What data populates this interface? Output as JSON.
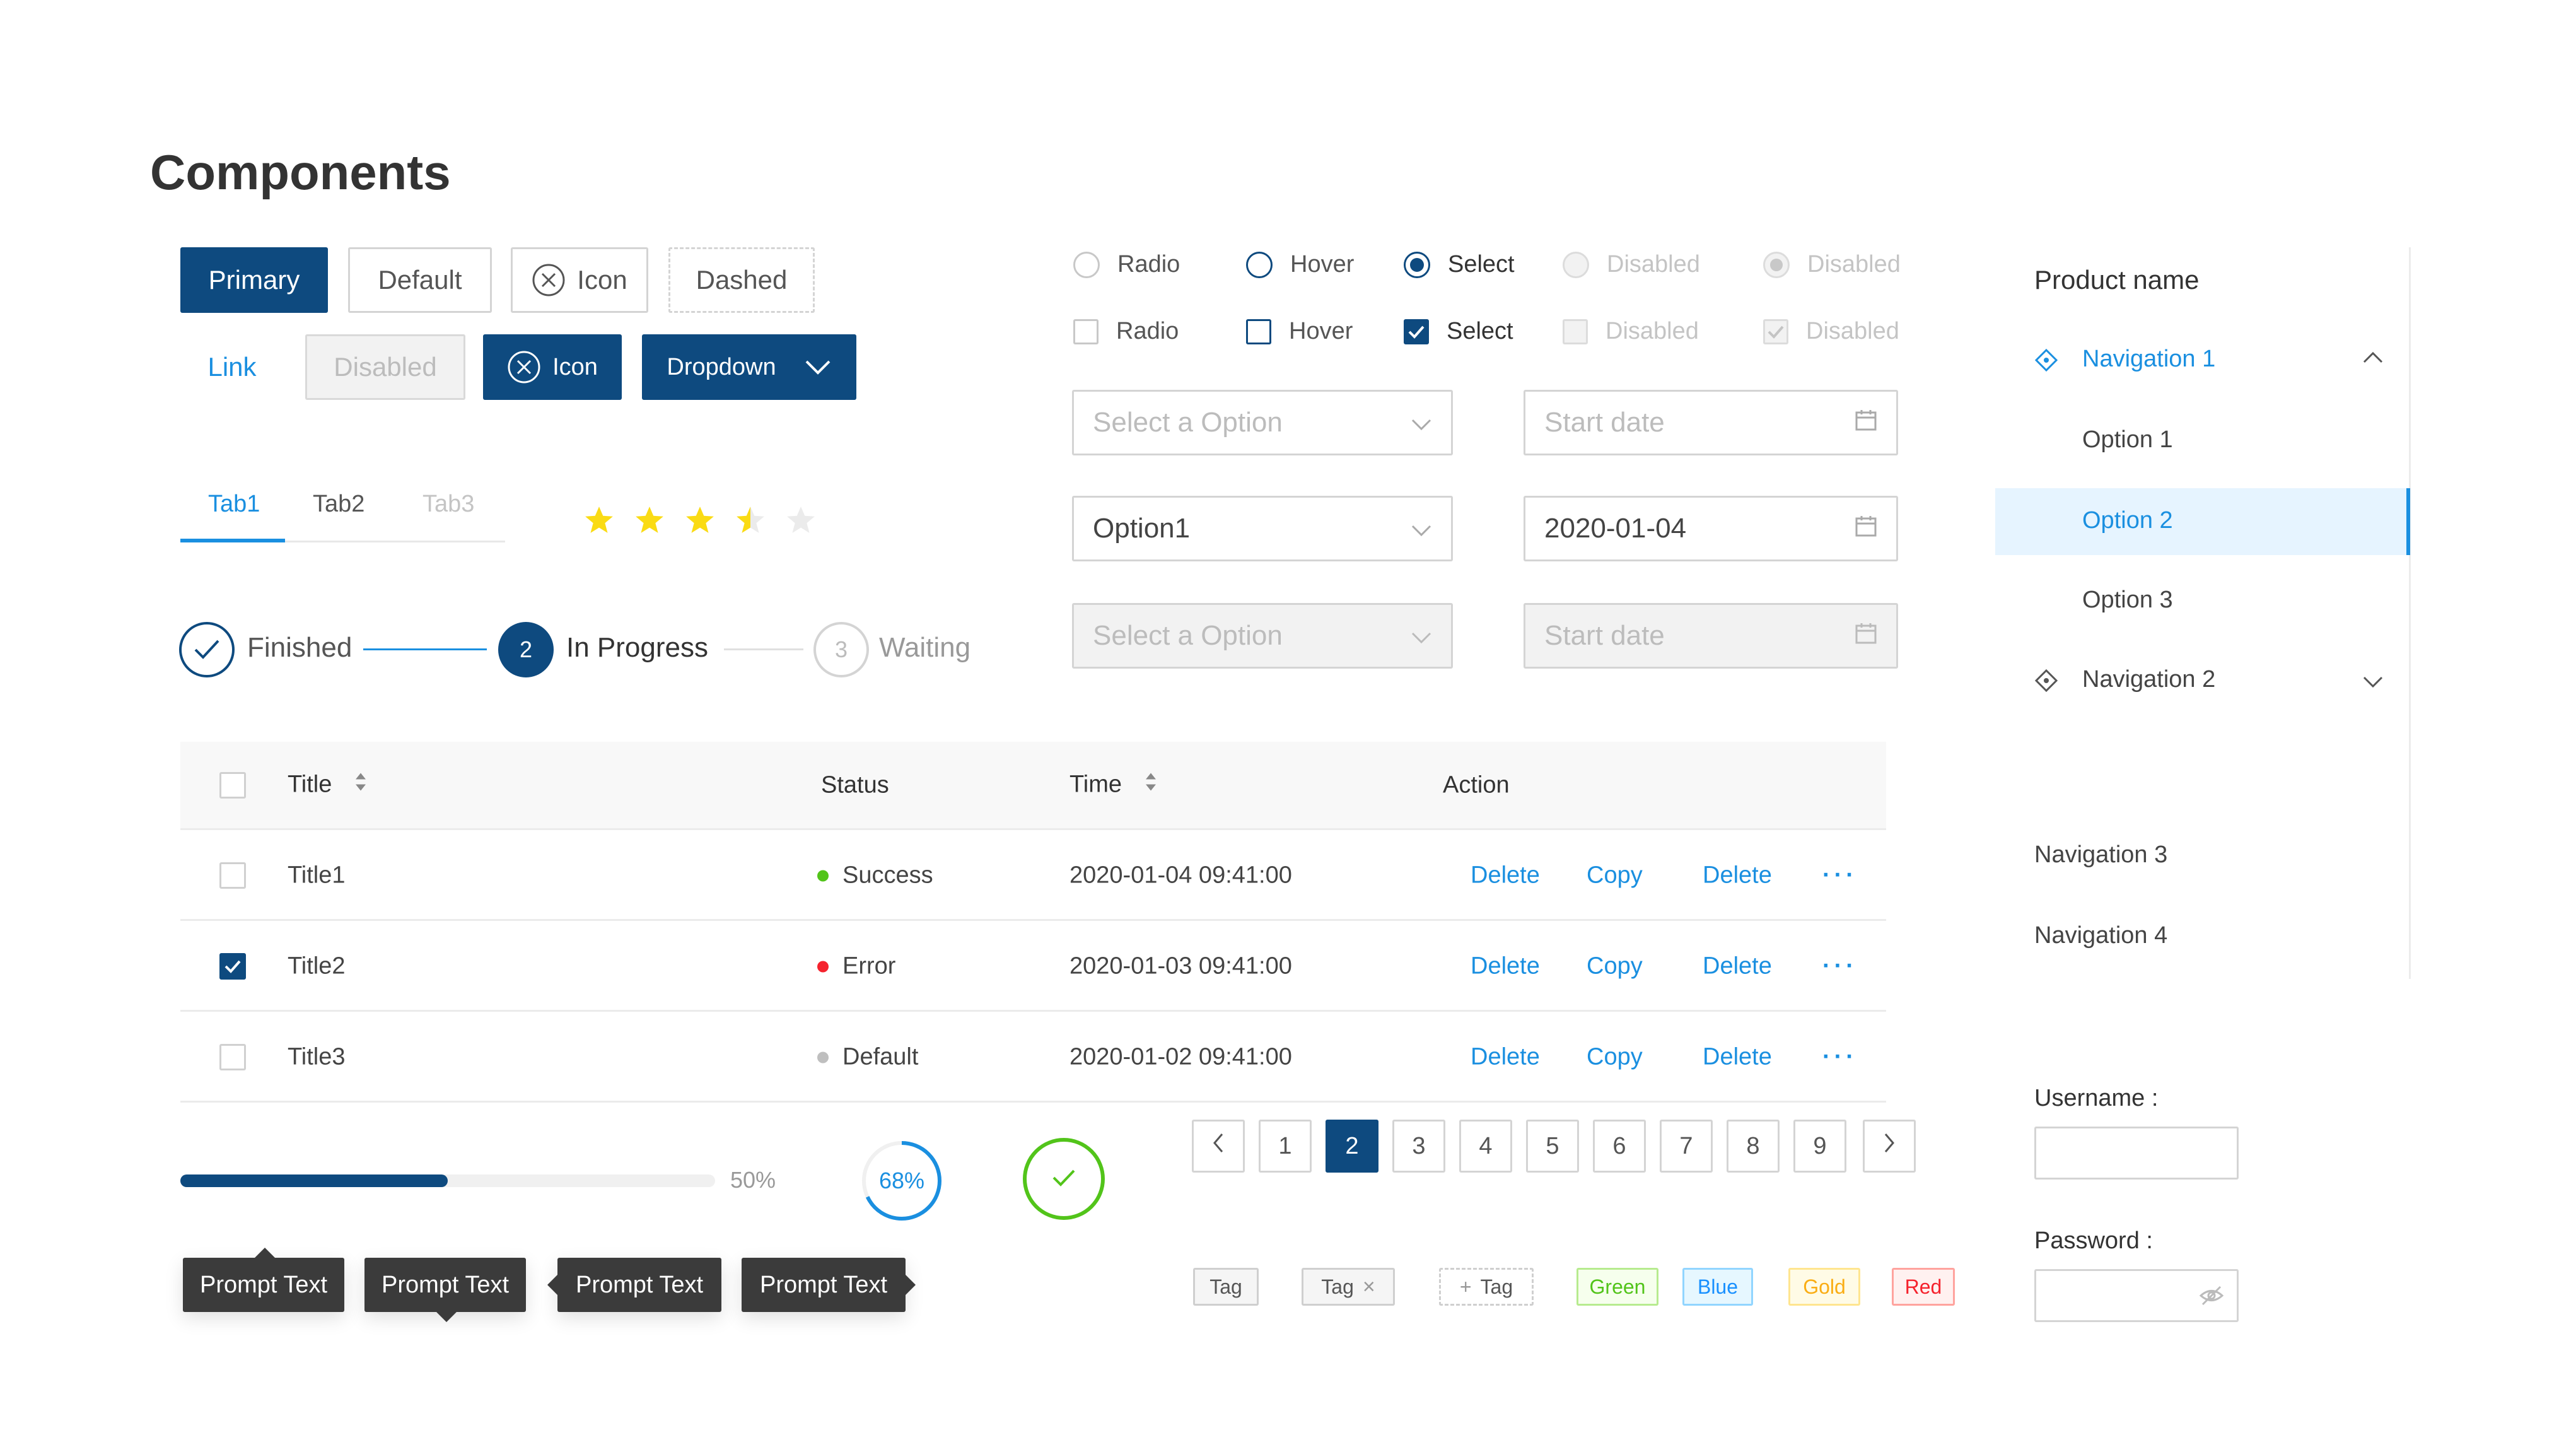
{
  "title": "Components",
  "buttons": {
    "primary": "Primary",
    "default": "Default",
    "icon": "Icon",
    "dashed": "Dashed",
    "link": "Link",
    "disabled": "Disabled",
    "icon_primary": "Icon",
    "dropdown": "Dropdown"
  },
  "tabs": [
    "Tab1",
    "Tab2",
    "Tab3"
  ],
  "rating": {
    "value": 3.5,
    "max": 5
  },
  "steps": [
    {
      "label": "Finished",
      "status": "finished"
    },
    {
      "label": "In Progress",
      "number": "2",
      "status": "process"
    },
    {
      "label": "Waiting",
      "number": "3",
      "status": "wait"
    }
  ],
  "radios": [
    "Radio",
    "Hover",
    "Select",
    "Disabled",
    "Disabled"
  ],
  "checkboxes": [
    "Radio",
    "Hover",
    "Select",
    "Disabled",
    "Disabled"
  ],
  "selects": {
    "placeholder": "Select a Option",
    "value": "Option1",
    "disabled_placeholder": "Select a Option"
  },
  "dates": {
    "placeholder": "Start date",
    "value": "2020-01-04",
    "disabled_placeholder": "Start date"
  },
  "table": {
    "headers": {
      "title": "Title",
      "status": "Status",
      "time": "Time",
      "action": "Action"
    },
    "rows": [
      {
        "title": "Title1",
        "status": "Success",
        "status_color": "#52c41a",
        "time": "2020-01-04  09:41:00",
        "checked": false
      },
      {
        "title": "Title2",
        "status": "Error",
        "status_color": "#f5222d",
        "time": "2020-01-03  09:41:00",
        "checked": true
      },
      {
        "title": "Title3",
        "status": "Default",
        "status_color": "#bfbfbf",
        "time": "2020-01-02  09:41:00",
        "checked": false
      }
    ],
    "actions": [
      "Delete",
      "Copy",
      "Delete"
    ],
    "more": "···"
  },
  "progress": {
    "line_percent": 50,
    "line_label": "50%",
    "circle_percent": 68,
    "circle_label": "68%",
    "done_percent": 100
  },
  "pagination": {
    "pages": [
      "1",
      "2",
      "3",
      "4",
      "5",
      "6",
      "7",
      "8",
      "9"
    ],
    "current": "2"
  },
  "tooltips": [
    "Prompt Text",
    "Prompt Text",
    "Prompt Text",
    "Prompt Text"
  ],
  "tags": {
    "plain": "Tag",
    "closable": "Tag",
    "close_glyph": "×",
    "add": "Tag",
    "add_glyph": "+",
    "green": "Green",
    "blue": "Blue",
    "gold": "Gold",
    "red": "Red"
  },
  "colors": {
    "primary": "#0e4a7f",
    "link": "#1a8fe0",
    "success": "#52c41a",
    "error": "#f5222d",
    "star": "#fadb14"
  },
  "menu": {
    "product_name": "Product name",
    "nav1": "Navigation 1",
    "options": [
      "Option 1",
      "Option 2",
      "Option 3"
    ],
    "nav2": "Navigation 2",
    "nav3": "Navigation 3",
    "nav4": "Navigation 4"
  },
  "form": {
    "username_label": "Username :",
    "password_label": "Password :"
  }
}
